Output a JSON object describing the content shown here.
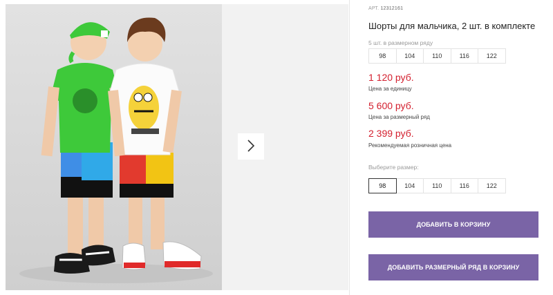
{
  "gallery": {
    "next_icon": "chevron-right-icon"
  },
  "product": {
    "sku_label": "АРТ.",
    "sku_value": "12312161",
    "title": "Шорты для мальчика, 2 шт. в комплекте",
    "size_run_label": "5 шт. в размерном ряду",
    "size_run": [
      "98",
      "104",
      "110",
      "116",
      "122"
    ],
    "prices": [
      {
        "value": "1 120 руб.",
        "caption": "Цена за единицу"
      },
      {
        "value": "5 600 руб.",
        "caption": "Цена за размерный ряд"
      },
      {
        "value": "2 399 руб.",
        "caption": "Рекомендуемая розничная цена"
      }
    ],
    "choose_size_label": "Выберите размер:",
    "sizes": [
      "98",
      "104",
      "110",
      "116",
      "122"
    ],
    "selected_size": "98",
    "add_to_cart": "ДОБАВИТЬ В КОРЗИНУ",
    "add_run_to_cart": "ДОБАВИТЬ РАЗМЕРНЫЙ РЯД В КОРЗИНУ"
  },
  "colors": {
    "price": "#d31f2e",
    "button": "#7a64a6",
    "photo_bg": "#dcdcdc"
  }
}
